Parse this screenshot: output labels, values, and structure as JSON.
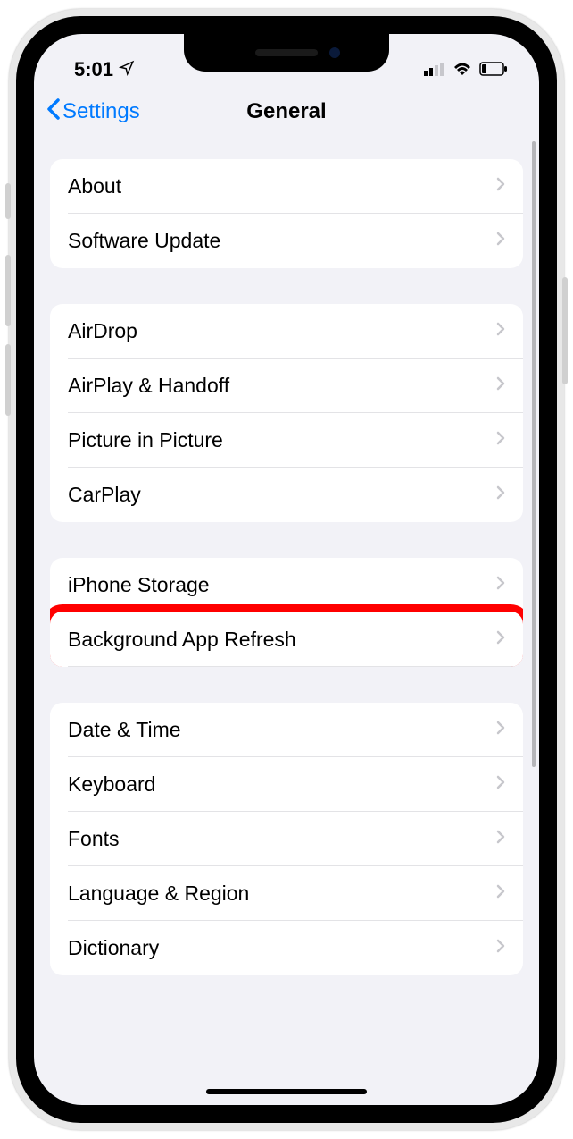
{
  "status": {
    "time": "5:01",
    "location_icon": "location-arrow",
    "signal_bars": 2,
    "wifi": true,
    "battery_low": true
  },
  "nav": {
    "back_label": "Settings",
    "title": "General"
  },
  "groups": [
    {
      "rows": [
        {
          "label": "About"
        },
        {
          "label": "Software Update"
        }
      ]
    },
    {
      "rows": [
        {
          "label": "AirDrop"
        },
        {
          "label": "AirPlay & Handoff"
        },
        {
          "label": "Picture in Picture"
        },
        {
          "label": "CarPlay"
        }
      ]
    },
    {
      "rows": [
        {
          "label": "iPhone Storage"
        },
        {
          "label": "Background App Refresh",
          "highlighted": true
        }
      ]
    },
    {
      "rows": [
        {
          "label": "Date & Time"
        },
        {
          "label": "Keyboard"
        },
        {
          "label": "Fonts"
        },
        {
          "label": "Language & Region"
        },
        {
          "label": "Dictionary"
        }
      ]
    }
  ],
  "highlight": {
    "color": "#ff0000"
  }
}
